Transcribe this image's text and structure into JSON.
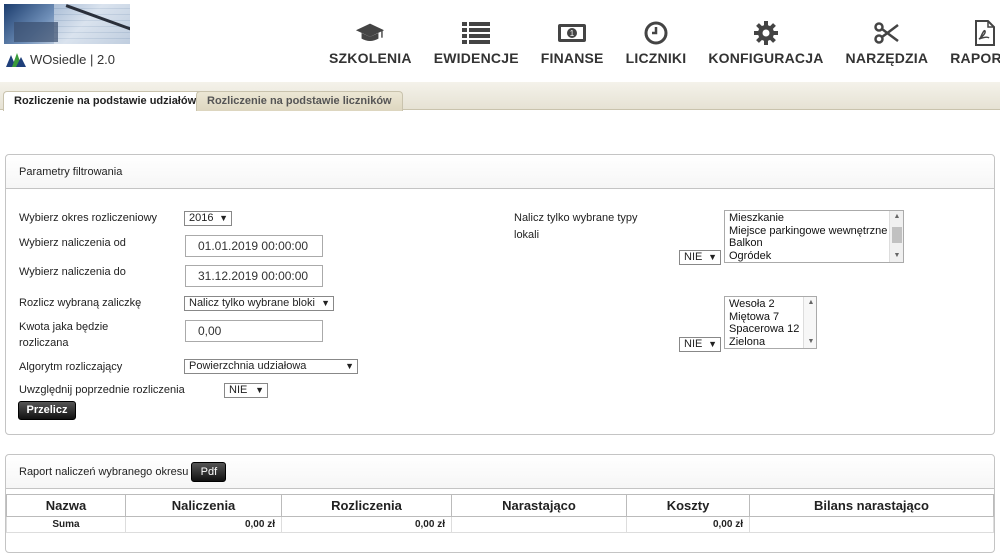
{
  "header": {
    "brand": "WOsiedle | 2.0",
    "nav": [
      {
        "label": "SZKOLENIA",
        "icon": "graduation-cap-icon"
      },
      {
        "label": "EWIDENCJE",
        "icon": "list-icon"
      },
      {
        "label": "FINANSE",
        "icon": "money-icon"
      },
      {
        "label": "LICZNIKI",
        "icon": "clock-icon"
      },
      {
        "label": "KONFIGURACJA",
        "icon": "gear-icon"
      },
      {
        "label": "NARZĘDZIA",
        "icon": "scissors-icon"
      },
      {
        "label": "RAPORTY",
        "icon": "pdf-file-icon"
      }
    ]
  },
  "tabs": [
    {
      "label": "Rozliczenie na podstawie udziałów",
      "active": true
    },
    {
      "label": "Rozliczenie na podstawie liczników",
      "active": false
    }
  ],
  "filters": {
    "title": "Parametry filtrowania",
    "period_label": "Wybierz okres rozliczeniowy",
    "period_value": "2016",
    "from_label": "Wybierz naliczenia od",
    "from_value": "01.01.2019 00:00:00",
    "to_label": "Wybierz naliczenia do",
    "to_value": "31.12.2019 00:00:00",
    "advance_label": "Rozlicz wybraną zaliczkę",
    "advance_value": "Nalicz tylko wybrane bloki",
    "amount_label_1": "Kwota jaka będzie",
    "amount_label_2": "rozliczana",
    "amount_value": "0,00",
    "algorithm_label": "Algorytm rozliczający",
    "algorithm_value": "Powierzchnia udziałowa",
    "previous_label": "Uwzględnij poprzednie rozliczenia",
    "previous_value": "NIE",
    "recalc_button": "Przelicz",
    "types_label_1": "Nalicz tylko wybrane typy",
    "types_label_2": "lokali",
    "types_nie": "NIE",
    "types_options": [
      "Mieszkanie",
      "Miejsce parkingowe wewnętrzne",
      "Balkon",
      "Ogródek"
    ],
    "blocks_nie": "NIE",
    "blocks_options": [
      "Wesoła 2",
      "Miętowa 7",
      "Spacerowa 12",
      "Zielona"
    ]
  },
  "report": {
    "title": "Raport naliczeń wybranego okresu",
    "pdf_button": "Pdf",
    "columns": [
      "Nazwa",
      "Naliczenia",
      "Rozliczenia",
      "Narastająco",
      "Koszty",
      "Bilans narastająco"
    ],
    "rows": [
      [
        "Suma",
        "0,00 zł",
        "0,00 zł",
        "",
        "0,00 zł",
        ""
      ]
    ]
  }
}
